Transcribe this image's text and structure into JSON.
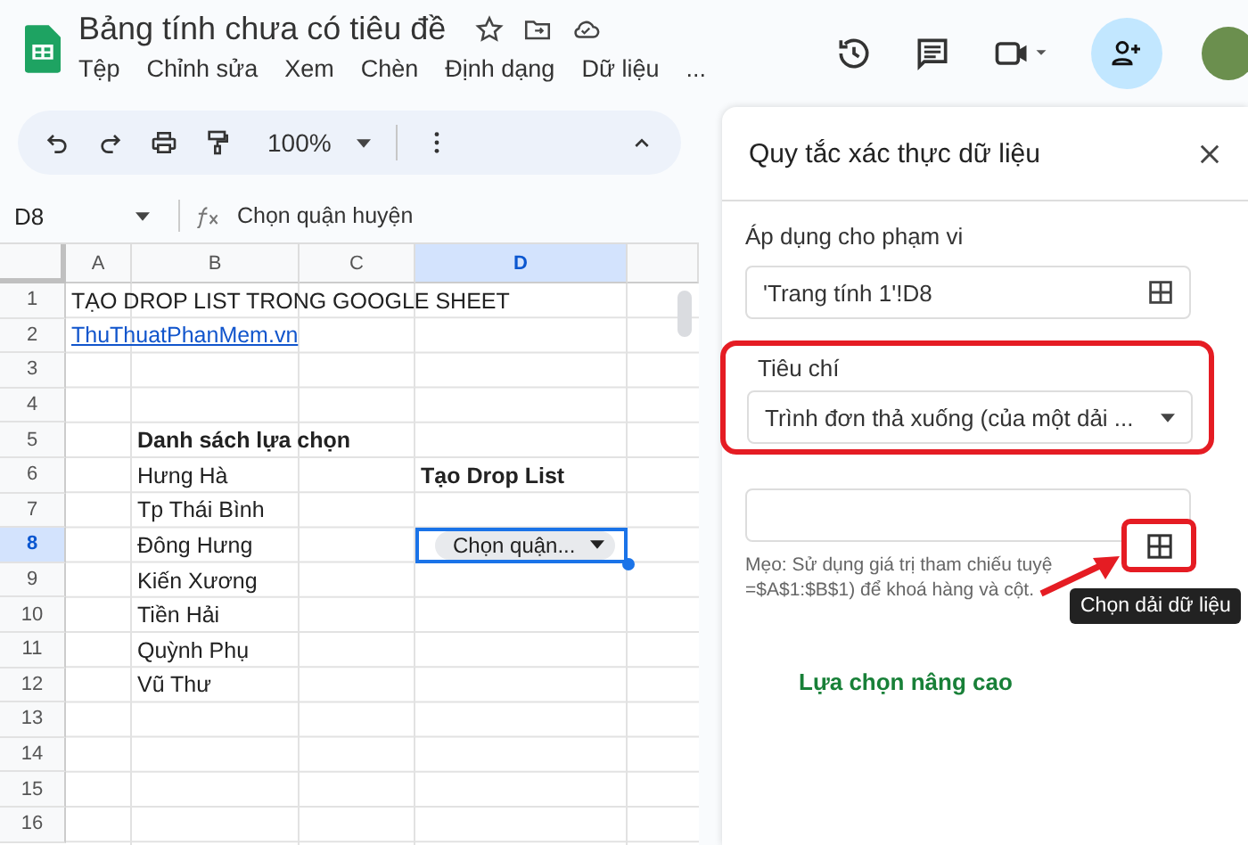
{
  "app": {
    "title": "Bảng tính chưa có tiêu đề",
    "menu": [
      "Tệp",
      "Chỉnh sửa",
      "Xem",
      "Chèn",
      "Định dạng",
      "Dữ liệu",
      "..."
    ]
  },
  "toolbar": {
    "zoom": "100%"
  },
  "formula_bar": {
    "cell": "D8",
    "formula": "Chọn quận huyện"
  },
  "sheet": {
    "columns": [
      {
        "label": "A",
        "selected": false
      },
      {
        "label": "B",
        "selected": false
      },
      {
        "label": "C",
        "selected": false
      },
      {
        "label": "D",
        "selected": true
      }
    ],
    "rows": [
      {
        "number": "1",
        "selected": false,
        "a": {
          "text": "TẠO DROP LIST TRONG GOOGLE SHEET",
          "kind": "text"
        }
      },
      {
        "number": "2",
        "selected": false,
        "a": {
          "text": "ThuThuatPhanMem.vn",
          "kind": "link"
        }
      },
      {
        "number": "3",
        "selected": false
      },
      {
        "number": "4",
        "selected": false
      },
      {
        "number": "5",
        "selected": false,
        "b": {
          "text": "Danh sách lựa chọn",
          "kind": "bold"
        }
      },
      {
        "number": "6",
        "selected": false,
        "b": {
          "text": "Hưng Hà",
          "kind": "text"
        },
        "d": {
          "text": "Tạo Drop List",
          "kind": "bold"
        }
      },
      {
        "number": "7",
        "selected": false,
        "b": {
          "text": "Tp Thái Bình",
          "kind": "text"
        }
      },
      {
        "number": "8",
        "selected": true,
        "b": {
          "text": "Đông Hưng",
          "kind": "text"
        },
        "d": {
          "text": "Chọn quận...",
          "kind": "chip"
        }
      },
      {
        "number": "9",
        "selected": false,
        "b": {
          "text": "Kiến Xương",
          "kind": "text"
        }
      },
      {
        "number": "10",
        "selected": false,
        "b": {
          "text": "Tiền Hải",
          "kind": "text"
        }
      },
      {
        "number": "11",
        "selected": false,
        "b": {
          "text": "Quỳnh Phụ",
          "kind": "text"
        }
      },
      {
        "number": "12",
        "selected": false,
        "b": {
          "text": "Vũ Thư",
          "kind": "text"
        }
      },
      {
        "number": "13",
        "selected": false
      },
      {
        "number": "14",
        "selected": false
      },
      {
        "number": "15",
        "selected": false
      },
      {
        "number": "16",
        "selected": false
      }
    ]
  },
  "panel": {
    "title": "Quy tắc xác thực dữ liệu",
    "range_label": "Áp dụng cho phạm vi",
    "range_value": "'Trang tính 1'!D8",
    "criteria_label": "Tiêu chí",
    "criteria_value": "Trình đơn thả xuống (của một dải ...",
    "hint_line_1": "Mẹo: Sử dụng giá trị tham chiếu tuyệ",
    "hint_line_2": "=$A$1:$B$1) để khoá hàng và cột.",
    "tooltip": "Chọn dải dữ liệu",
    "advanced_link": "Lựa chọn nâng cao"
  }
}
